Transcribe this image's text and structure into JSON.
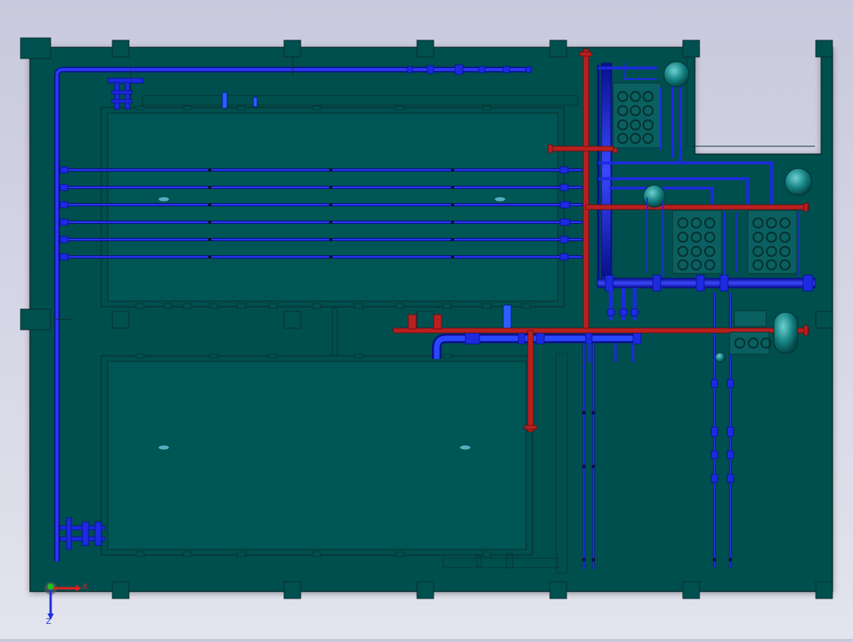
{
  "app": {
    "view": "top",
    "colors": {
      "background": "#d2d2e4",
      "floor": "#005050",
      "floor_edge": "#0a2e2e",
      "pipe_blue": "#1c2ae0",
      "pipe_blue_dark": "#0a0f8a",
      "pipe_red": "#b82020",
      "equipment": "#0a6060"
    }
  },
  "triad": {
    "x_label": "X",
    "z_label": "Z",
    "x_color": "#e02020",
    "y_color": "#20c020",
    "z_color": "#2030e0"
  }
}
